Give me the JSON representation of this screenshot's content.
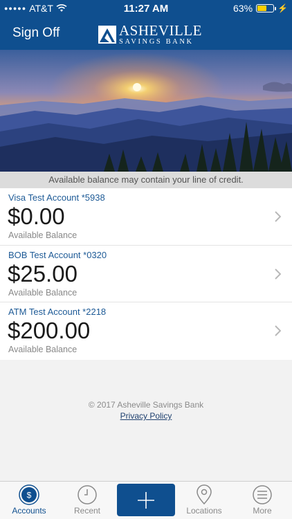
{
  "status_bar": {
    "carrier": "AT&T",
    "time": "11:27 AM",
    "battery": "63%",
    "battery_level": 0.63
  },
  "header": {
    "sign_off": "Sign Off",
    "logo_line1": "ASHEVILLE",
    "logo_line2": "SAVINGS BANK"
  },
  "notice": "Available balance may contain your line of credit.",
  "accounts": [
    {
      "name": "Visa Test Account *5938",
      "amount": "$0.00",
      "label": "Available Balance"
    },
    {
      "name": "BOB Test Account *0320",
      "amount": "$25.00",
      "label": "Available Balance"
    },
    {
      "name": "ATM Test Account *2218",
      "amount": "$200.00",
      "label": "Available Balance"
    }
  ],
  "footer": {
    "copyright": "© 2017 Asheville Savings Bank",
    "privacy": "Privacy Policy"
  },
  "tabs": {
    "accounts": "Accounts",
    "recent": "Recent",
    "locations": "Locations",
    "more": "More"
  },
  "colors": {
    "brand": "#0f4f8f",
    "link": "#1d5a96"
  }
}
